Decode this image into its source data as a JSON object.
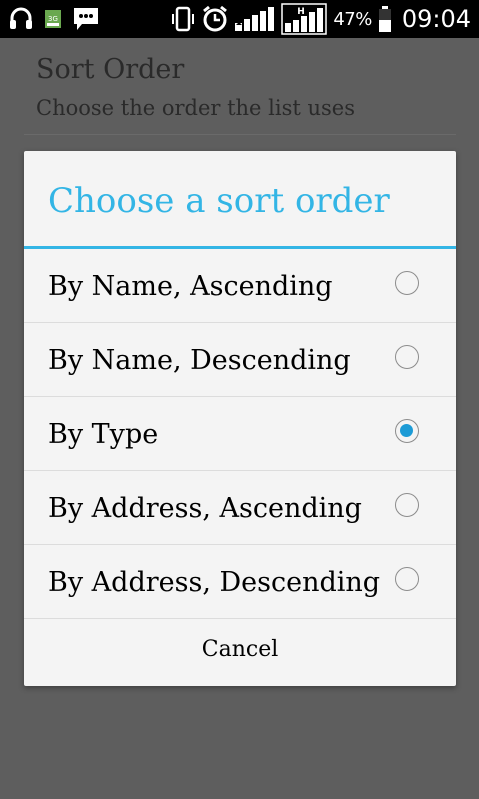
{
  "status_bar": {
    "battery_percent": "47%",
    "time": "09:04",
    "network_type": "3G",
    "signal_badge": "H",
    "icons": [
      "headset-icon",
      "3g-data-icon",
      "message-icon",
      "vibrate-icon",
      "alarm-icon",
      "signal-icon",
      "hsdpa-signal-icon",
      "battery-icon"
    ]
  },
  "preference": {
    "title": "Sort Order",
    "summary": "Choose the order the list uses"
  },
  "dialog": {
    "title": "Choose a sort order",
    "accent_color": "#33b5e5",
    "options": [
      {
        "label": "By Name, Ascending",
        "checked": false
      },
      {
        "label": "By Name, Descending",
        "checked": false
      },
      {
        "label": "By Type",
        "checked": true
      },
      {
        "label": "By Address, Ascending",
        "checked": false
      },
      {
        "label": "By Address, Descending",
        "checked": false
      }
    ],
    "cancel_label": "Cancel"
  }
}
